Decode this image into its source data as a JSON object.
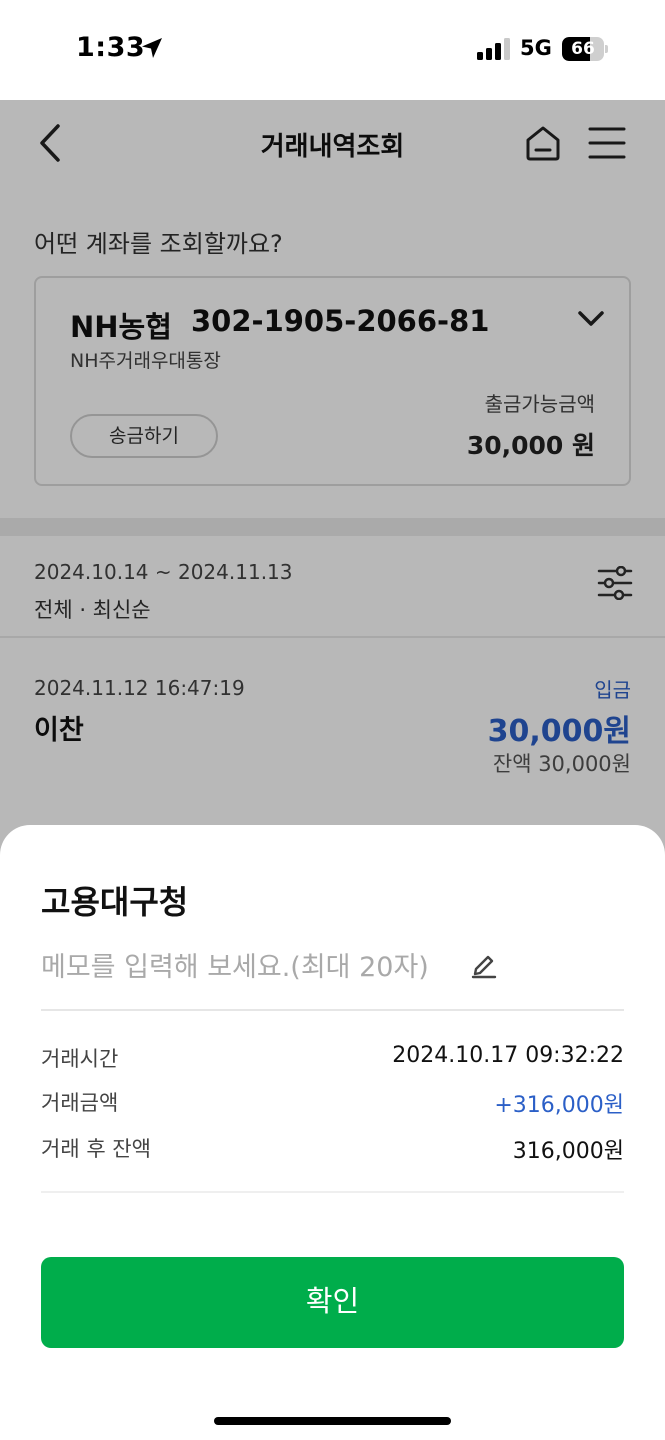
{
  "status_bar": {
    "time": "1:33",
    "network": "5G",
    "battery": "66",
    "battery_level": 0.66
  },
  "header": {
    "title": "거래내역조회",
    "back_icon": "back-chevron-icon",
    "home_icon": "home-icon",
    "menu_icon": "hamburger-menu-icon"
  },
  "account_section": {
    "question": "어떤 계좌를 조회할까요?",
    "bank": "NH농협",
    "account_number": "302-1905-2066-81",
    "account_type": "NH주거래우대통장",
    "transfer_label": "송금하기",
    "available_label": "출금가능금액",
    "available_amount": "30,000 원"
  },
  "filter": {
    "date_range": "2024.10.14 ~ 2024.11.13",
    "sort": "전체 · 최신순",
    "icon": "filter-sliders-icon"
  },
  "transactions": [
    {
      "datetime": "2024.11.12 16:47:19",
      "name": "이찬",
      "type": "입금",
      "amount": "30,000원",
      "balance": "잔액 30,000원"
    }
  ],
  "sheet": {
    "title": "고용대구청",
    "memo_placeholder": "메모를 입력해 보세요.(최대 20자)",
    "memo_icon": "pencil-icon",
    "details": [
      {
        "label": "거래시간",
        "value": "2024.10.17 09:32:22"
      },
      {
        "label": "거래금액",
        "value": "+316,000원"
      },
      {
        "label": "거래 후 잔액",
        "value": "316,000원"
      }
    ],
    "confirm_label": "확인"
  },
  "colors": {
    "primary_green": "#00ad4b",
    "deposit_blue": "#2b5fc7"
  }
}
